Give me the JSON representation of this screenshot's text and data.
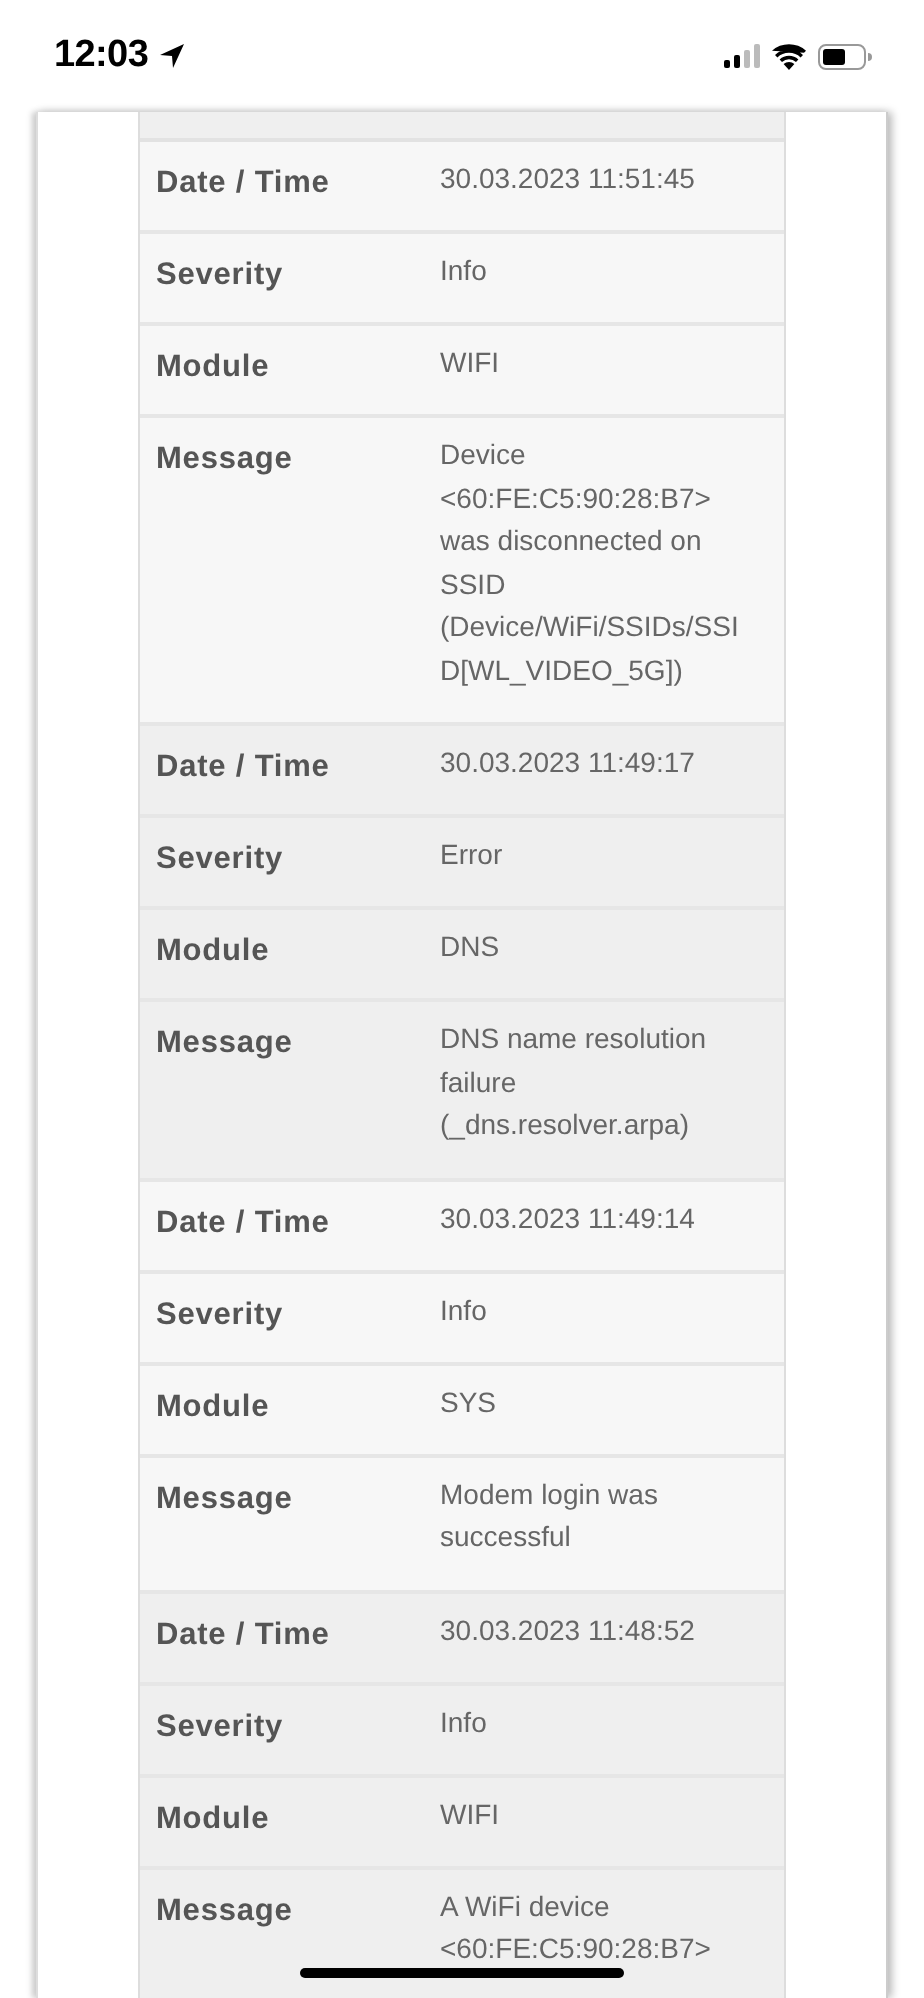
{
  "status_bar": {
    "time": "12:03"
  },
  "log_entries": [
    {
      "fields": [
        {
          "label": "Date / Time",
          "value": "30.03.2023 11:51:45"
        },
        {
          "label": "Severity",
          "value": "Info"
        },
        {
          "label": "Module",
          "value": "WIFI"
        },
        {
          "label": "Message",
          "value": "Device <60:FE:C5:90:28:B7> was disconnected on SSID (Device/WiFi/SSIDs/SSID[WL_VIDEO_5G])"
        }
      ]
    },
    {
      "fields": [
        {
          "label": "Date / Time",
          "value": "30.03.2023 11:49:17"
        },
        {
          "label": "Severity",
          "value": "Error"
        },
        {
          "label": "Module",
          "value": "DNS"
        },
        {
          "label": "Message",
          "value": "DNS name resolution failure (_dns.resolver.arpa)"
        }
      ]
    },
    {
      "fields": [
        {
          "label": "Date / Time",
          "value": "30.03.2023 11:49:14"
        },
        {
          "label": "Severity",
          "value": "Info"
        },
        {
          "label": "Module",
          "value": "SYS"
        },
        {
          "label": "Message",
          "value": "Modem login was successful"
        }
      ]
    },
    {
      "fields": [
        {
          "label": "Date / Time",
          "value": "30.03.2023 11:48:52"
        },
        {
          "label": "Severity",
          "value": "Info"
        },
        {
          "label": "Module",
          "value": "WIFI"
        },
        {
          "label": "Message",
          "value": "A WiFi device <60:FE:C5:90:28:B7>"
        }
      ]
    }
  ]
}
